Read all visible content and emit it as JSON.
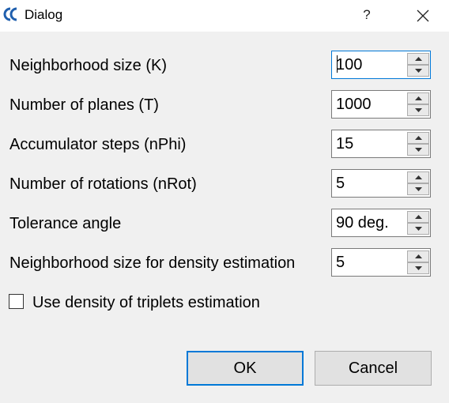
{
  "window": {
    "title": "Dialog",
    "help_label": "?",
    "app_icon": "cloudcompare-logo-icon",
    "close_icon": "close-icon"
  },
  "fields": [
    {
      "label": "Neighborhood size (K)",
      "value": "100"
    },
    {
      "label": "Number of planes (T)",
      "value": "1000"
    },
    {
      "label": "Accumulator steps (nPhi)",
      "value": "15"
    },
    {
      "label": "Number of rotations (nRot)",
      "value": "5"
    },
    {
      "label": "Tolerance angle",
      "value": "90 deg."
    },
    {
      "label": "Neighborhood size for density estimation",
      "value": "5"
    }
  ],
  "checkbox": {
    "label": "Use density of triplets estimation",
    "checked": false
  },
  "buttons": {
    "ok": "OK",
    "cancel": "Cancel"
  },
  "colors": {
    "accent": "#0078d7",
    "icon_blue": "#1f5fae"
  }
}
